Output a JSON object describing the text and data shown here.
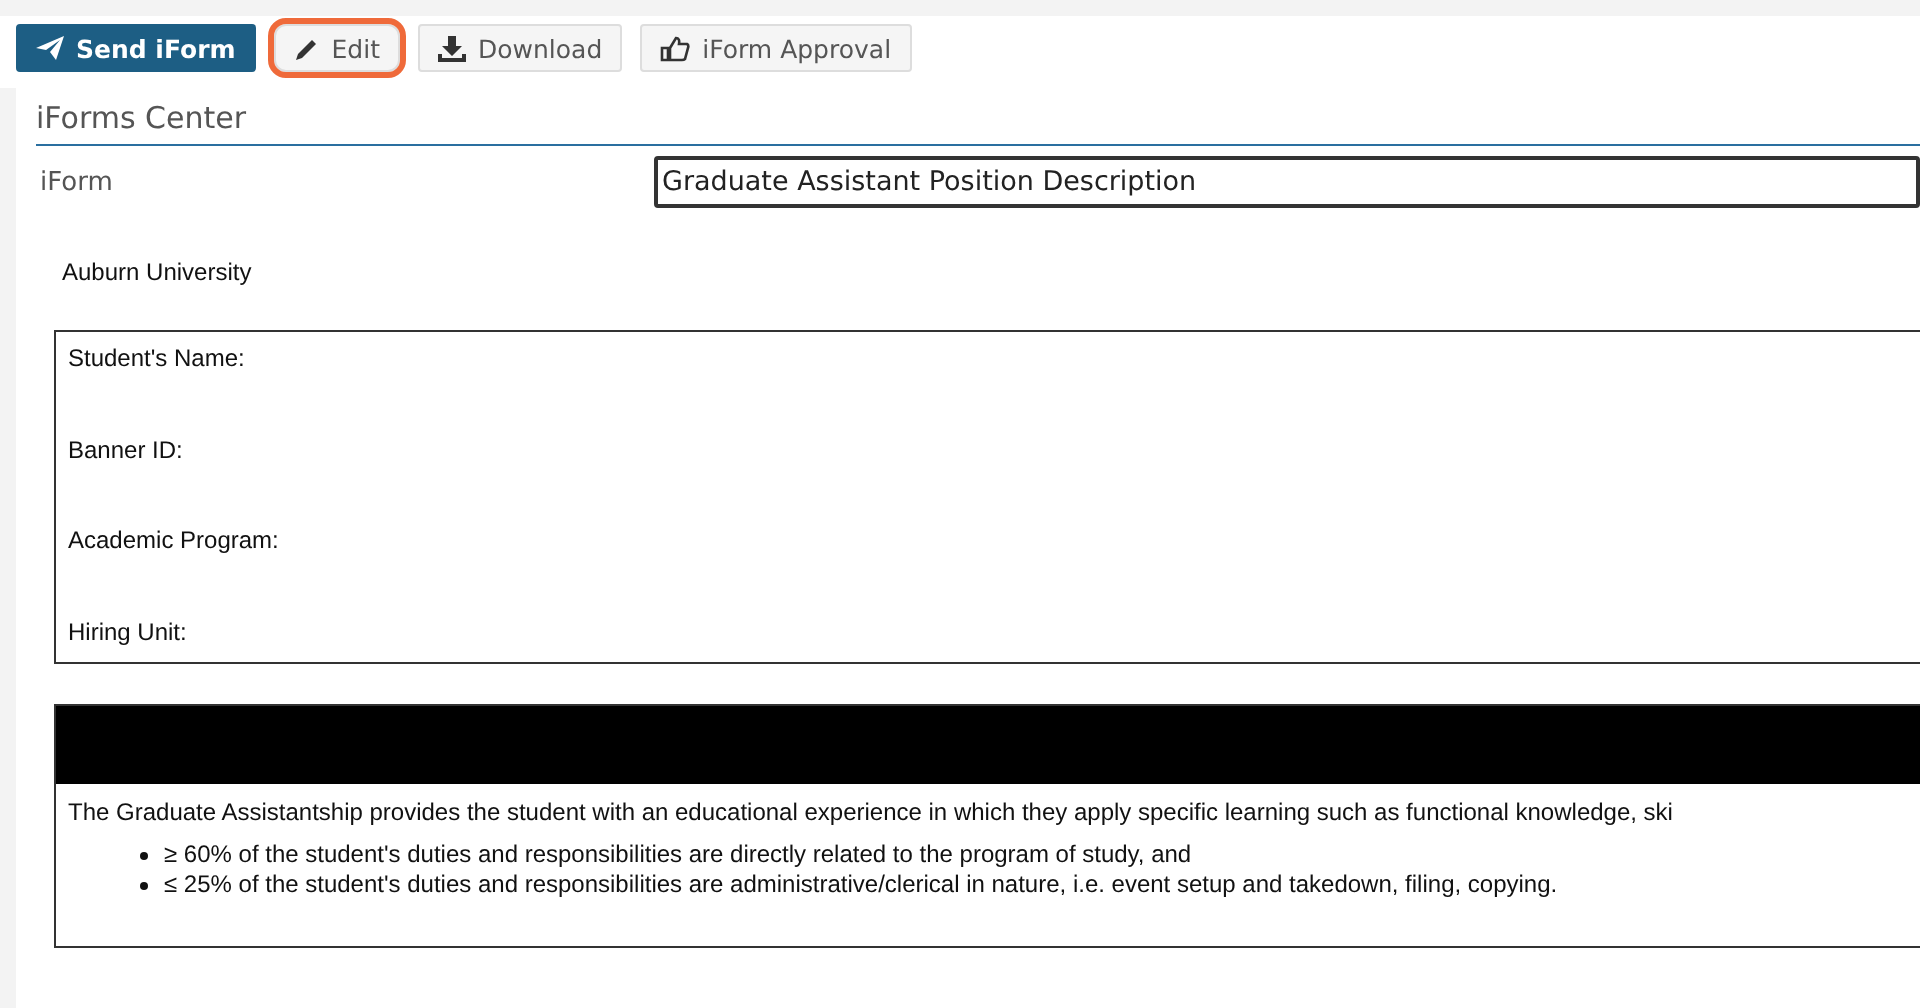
{
  "toolbar": [
    {
      "kind": "send",
      "label": "Send iForm",
      "highlighted": false
    },
    {
      "kind": "edit",
      "label": "Edit",
      "highlighted": true
    },
    {
      "kind": "download",
      "label": "Download",
      "highlighted": false
    },
    {
      "kind": "approval",
      "label": "iForm Approval",
      "highlighted": false
    }
  ],
  "section_title": "iForms Center",
  "iform": {
    "label": "iForm",
    "value": "Graduate Assistant Position Description"
  },
  "document": {
    "institution": "Auburn University",
    "fields": [
      "Student's Name:",
      "Banner ID:",
      "Academic Program:",
      "Hiring Unit:"
    ],
    "intro": "The Graduate Assistantship provides the student with an educational experience in which they apply specific learning such as functional knowledge, ski",
    "bullets": [
      "≥ 60% of the student's duties and responsibilities are directly related to the program of study, and",
      "≤ 25% of the student's duties and responsibilities are administrative/clerical in nature, i.e. event setup and takedown, filing, copying."
    ]
  }
}
